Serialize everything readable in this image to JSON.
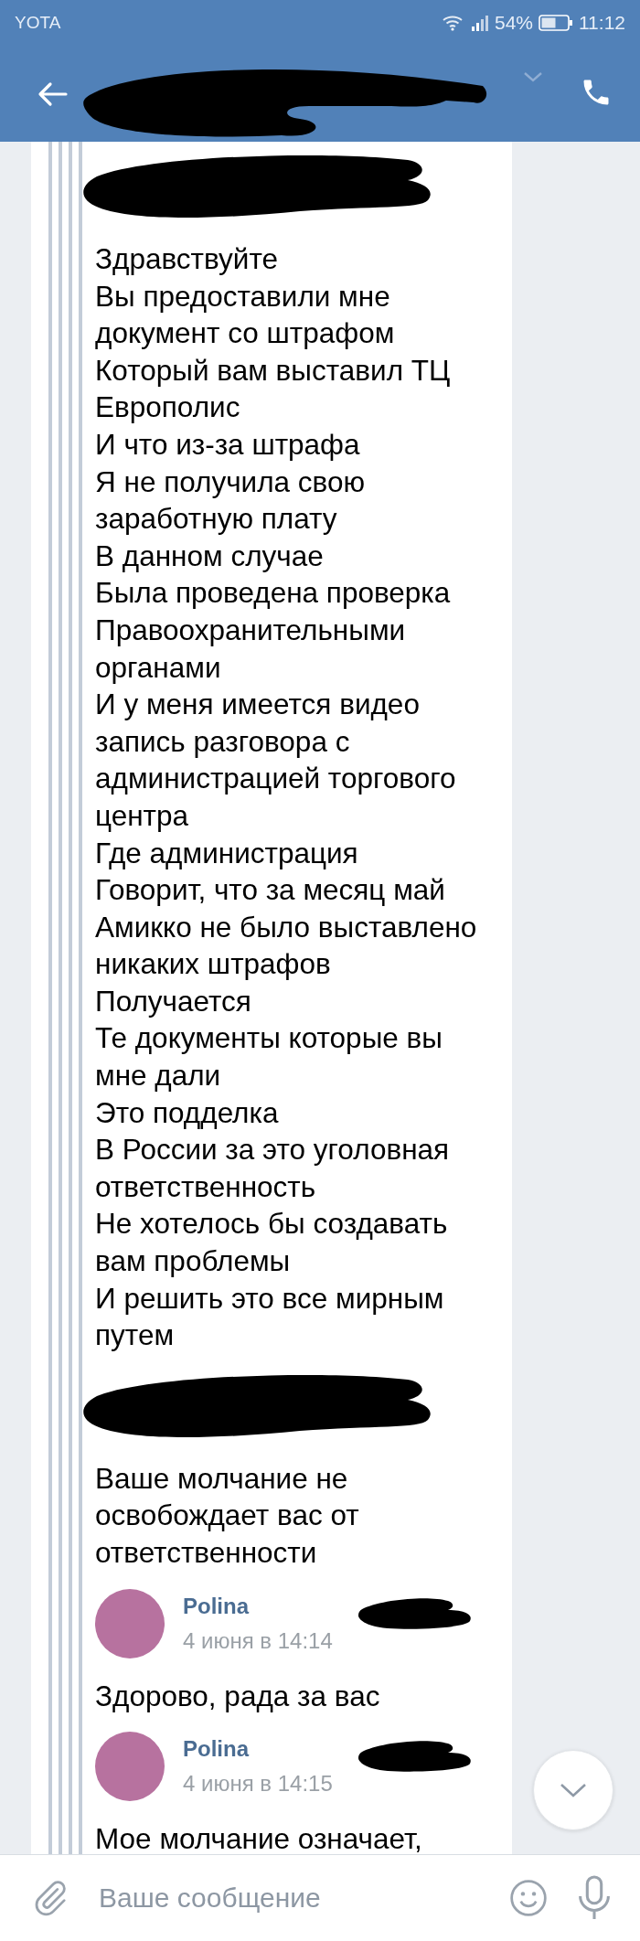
{
  "status_bar": {
    "carrier": "YOTA",
    "battery": "54%",
    "time": "11:12"
  },
  "messages": [
    {
      "kind": "redacted",
      "text": "Здравствуйте\nВы предоставили мне документ со штрафом\nКоторый вам выставил ТЦ Европолис\nИ что из-за штрафа\nЯ не получила свою заработную плату\nВ данном случае\nБыла проведена проверка\nПравоохранительными органами\nИ у меня имеется видео запись разговора с администрацией торгового центра\nГде администрация\nГоворит, что за месяц май\nАмикко не было выставлено никаких штрафов\nПолучается\nТе документы которые вы мне дали\nЭто подделка\nВ России за это уголовная ответственность\nНе хотелось бы создавать вам проблемы\nИ решить это все мирным путем"
    },
    {
      "kind": "redacted",
      "text": "Ваше молчание не освобождает вас от ответственности"
    },
    {
      "kind": "named",
      "author": "Polina",
      "date": "4 июня в 14:14",
      "text": "Здорово, рада за вас"
    },
    {
      "kind": "named",
      "author": "Polina",
      "date": "4 июня в 14:15",
      "text": "Мое молчание означает,"
    }
  ],
  "composer": {
    "placeholder": "Ваше сообщение"
  }
}
